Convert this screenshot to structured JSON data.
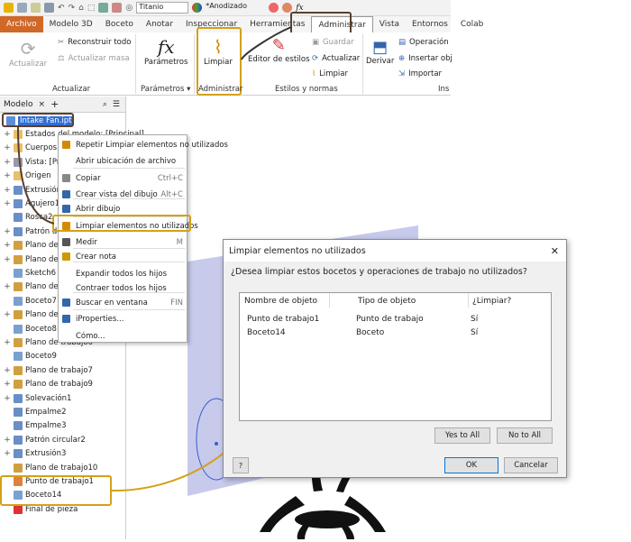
{
  "window_title": "Titanio",
  "material": "*Anodizado",
  "tabs": [
    "Archivo",
    "Modelo 3D",
    "Boceto",
    "Anotar",
    "Inspeccionar",
    "Herramientas",
    "Administrar",
    "Vista",
    "Entornos",
    "Colab"
  ],
  "ribbon": {
    "actualizar": "Actualizar",
    "reconstruir": "Reconstruir todo",
    "actualizar_masa": "Actualizar masa",
    "grp_actualizar": "Actualizar",
    "parametros": "Parámetros",
    "grp_parametros": "Parámetros",
    "limpiar": "Limpiar",
    "grp_administrar": "Administrar",
    "editor_estilos": "Editor de estilos",
    "guardar": "Guardar",
    "actualizar2": "Actualizar",
    "limpiar2": "Limpiar",
    "grp_estilos": "Estilos y normas",
    "derivar": "Derivar",
    "operacion": "Operación",
    "insertar": "Insertar obj",
    "importar": "Importar",
    "grp_ins": "Ins"
  },
  "browser": {
    "tab": "Modelo",
    "root": "Intake Fan.ipt",
    "items": [
      "Estados del modelo: [Principal]",
      "Cuerpos",
      "Vista: [Pr",
      "Origen",
      "Extrusión",
      "Agujero1",
      "Rosca2",
      "Patrón de",
      "Plano de",
      "Plano de",
      "Sketch6",
      "Plano de",
      "Boceto7",
      "Plano de",
      "Boceto8",
      "Plano de trabajo6",
      "Boceto9",
      "Plano de trabajo7",
      "Plano de trabajo9",
      "Solevación1",
      "Empalme2",
      "Empalme3",
      "Patrón circular2",
      "Extrusión3",
      "Plano de trabajo10",
      "Punto de trabajo1",
      "Boceto14",
      "Final de pieza"
    ]
  },
  "context_menu": [
    {
      "label": "Repetir Limpiar elementos no utilizados",
      "shortcut": ""
    },
    {
      "label": "Abrir ubicación de archivo",
      "shortcut": ""
    },
    {
      "label": "Copiar",
      "shortcut": "Ctrl+C"
    },
    {
      "label": "Crear vista del dibujo",
      "shortcut": "Alt+C"
    },
    {
      "label": "Abrir dibujo",
      "shortcut": ""
    },
    {
      "label": "Limpiar elementos no utilizados",
      "shortcut": ""
    },
    {
      "label": "Medir",
      "shortcut": "M"
    },
    {
      "label": "Crear nota",
      "shortcut": ""
    },
    {
      "label": "Expandir todos los hijos",
      "shortcut": ""
    },
    {
      "label": "Contraer todos los hijos",
      "shortcut": ""
    },
    {
      "label": "Buscar en ventana",
      "shortcut": "FIN"
    },
    {
      "label": "iProperties...",
      "shortcut": ""
    },
    {
      "label": "Cómo...",
      "shortcut": ""
    }
  ],
  "dialog": {
    "title": "Limpiar elementos no utilizados",
    "question": "¿Desea limpiar estos bocetos y operaciones de trabajo no utilizados?",
    "columns": [
      "Nombre de objeto",
      "Tipo de objeto",
      "¿Limpiar?"
    ],
    "rows": [
      [
        "Punto de trabajo1",
        "Punto de trabajo",
        "Sí"
      ],
      [
        "Boceto14",
        "Boceto",
        "Sí"
      ]
    ],
    "yes_all": "Yes to All",
    "no_all": "No to All",
    "ok": "OK",
    "cancel": "Cancelar",
    "help": "?"
  },
  "colors": {
    "accent": "#d4a017",
    "file_tab": "#d06828",
    "brown": "#5a4030"
  }
}
